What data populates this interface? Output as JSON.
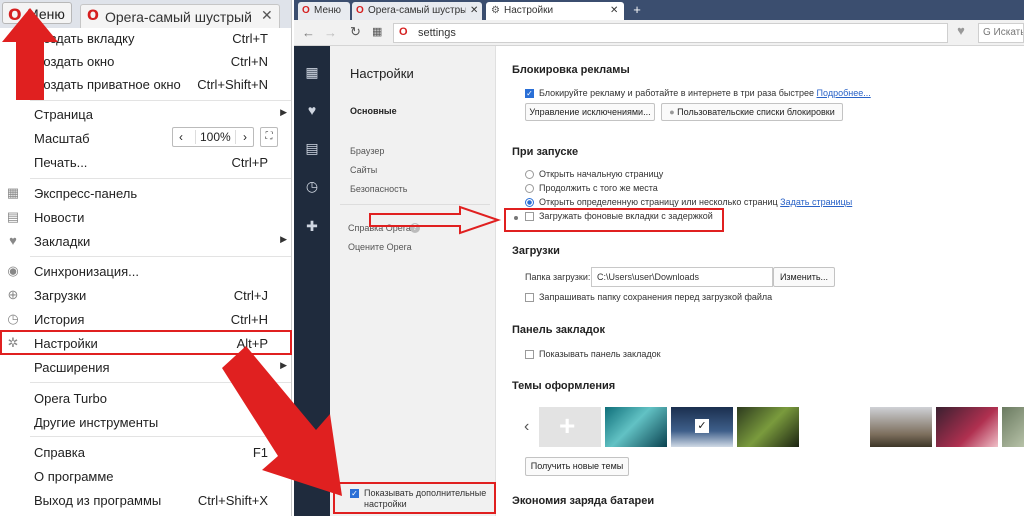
{
  "left_window": {
    "menu_button": {
      "icon": "opera-logo-icon",
      "label": "Меню"
    },
    "tab_title": "Opera-самый шустрый и д..."
  },
  "menu": {
    "items": [
      {
        "label": "Создать вкладку",
        "shortcut": "Ctrl+T"
      },
      {
        "label": "Создать окно",
        "shortcut": "Ctrl+N"
      },
      {
        "label": "Создать приватное окно",
        "shortcut": "Ctrl+Shift+N"
      },
      {
        "label": "Страница",
        "shortcut": ""
      },
      {
        "label": "Масштаб",
        "shortcut": ""
      },
      {
        "label": "Печать...",
        "shortcut": "Ctrl+P"
      },
      {
        "label": "Экспресс-панель",
        "shortcut": ""
      },
      {
        "label": "Новости",
        "shortcut": ""
      },
      {
        "label": "Закладки",
        "shortcut": ""
      },
      {
        "label": "Синхронизация...",
        "shortcut": ""
      },
      {
        "label": "Загрузки",
        "shortcut": "Ctrl+J"
      },
      {
        "label": "История",
        "shortcut": "Ctrl+H"
      },
      {
        "label": "Настройки",
        "shortcut": "Alt+P"
      },
      {
        "label": "Расширения",
        "shortcut": ""
      },
      {
        "label": "Opera Turbo",
        "shortcut": ""
      },
      {
        "label": "Другие инструменты",
        "shortcut": ""
      },
      {
        "label": "Справка",
        "shortcut": "F1"
      },
      {
        "label": "О программе",
        "shortcut": ""
      },
      {
        "label": "Выход из программы",
        "shortcut": "Ctrl+Shift+X"
      }
    ],
    "zoom": {
      "minus": "‹",
      "value": "100%",
      "plus": "›",
      "fullscreen": "⛶"
    }
  },
  "browser": {
    "tabs": [
      {
        "label": "Меню"
      },
      {
        "label": "Opera-самый шустрый и..."
      },
      {
        "label": "Настройки"
      }
    ],
    "address": "settings",
    "search_placeholder": "G Искать в G"
  },
  "settings_nav": {
    "title": "Настройки",
    "items": [
      "Основные",
      "Браузер",
      "Сайты",
      "Безопасность",
      "Справка Opera",
      "Оцените Opera"
    ],
    "advanced_checkbox": "Показывать дополнительные настройки"
  },
  "settings": {
    "ad_block": {
      "heading": "Блокировка рекламы",
      "checkbox": "Блокируйте рекламу и работайте в интернете в три раза быстрее",
      "more": "Подробнее...",
      "btn_exceptions": "Управление исключениями...",
      "btn_lists": "Пользовательские списки блокировки"
    },
    "startup": {
      "heading": "При запуске",
      "opt1": "Открыть начальную страницу",
      "opt2": "Продолжить с того же места",
      "opt3": "Открыть определенную страницу или несколько страниц",
      "set_pages": "Задать страницы",
      "delay_tabs": "Загружать фоновые вкладки с задержкой"
    },
    "downloads": {
      "heading": "Загрузки",
      "folder_label": "Папка загрузки:",
      "folder_value": "C:\\Users\\user\\Downloads",
      "change": "Изменить...",
      "ask": "Запрашивать папку сохранения перед загрузкой файла"
    },
    "bookmarks_bar": {
      "heading": "Панель закладок",
      "show": "Показывать панель закладок"
    },
    "themes": {
      "heading": "Темы оформления",
      "get_more": "Получить новые темы"
    },
    "battery": {
      "heading": "Экономия заряда батареи"
    }
  },
  "colors": {
    "accent": "#2a6fd6",
    "annotation_red": "#e02020",
    "sidebar": "#1f2b3d"
  }
}
